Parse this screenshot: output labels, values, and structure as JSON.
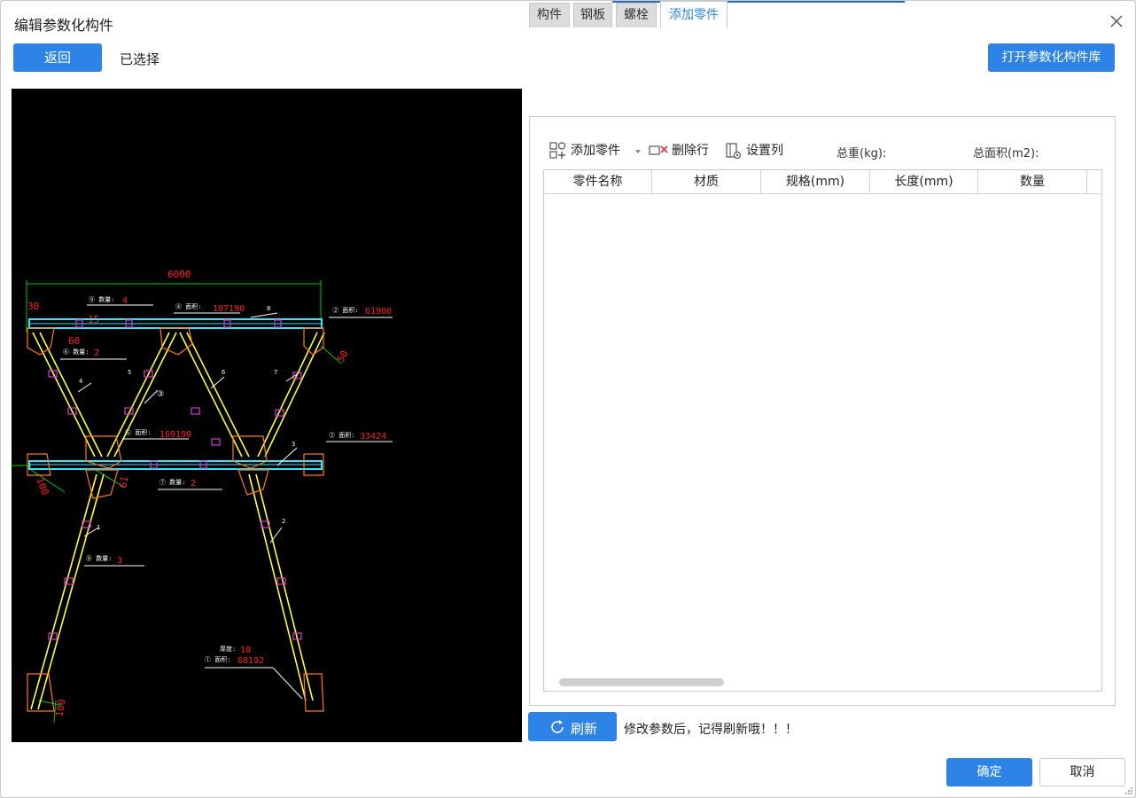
{
  "window": {
    "title": "编辑参数化构件",
    "close_icon": "close-icon"
  },
  "header": {
    "back_label": "返回",
    "selected_label": "已选择",
    "open_library_label": "打开参数化构件库"
  },
  "drawing": {
    "dimensions": {
      "top_width": "6000",
      "left_30": "30",
      "left_60": "60",
      "right_50": "50",
      "bottom_left_100": "100",
      "mid_100": "100",
      "mid_61": "61",
      "bottom_100": "100",
      "d15": "15"
    },
    "annotations": {
      "a_top_left": {
        "label": "⑨ 数量:",
        "value": "4"
      },
      "a_top_mid": {
        "label": "④ 面积:",
        "value": "107190"
      },
      "a_top_right": {
        "label": "② 面积:",
        "value": "61900"
      },
      "a_mid_left": {
        "label": "⑥ 数量:",
        "value": "2"
      },
      "a_center": {
        "label": "⑤ 面积:",
        "value": "169190"
      },
      "a_mid_right": {
        "label": "② 面积:",
        "value": "33424"
      },
      "a_low_center": {
        "label": "⑦ 数量:",
        "value": "2"
      },
      "a_low_left": {
        "label": "⑧ 数量:",
        "value": "3"
      },
      "a_bottom_thk": {
        "label": "厚度:",
        "value": "10"
      },
      "a_bottom_area": {
        "label": "① 面积:",
        "value": "68192"
      }
    },
    "part_marks": {
      "m8": "8",
      "m4": "4",
      "m5": "5",
      "m6": "6",
      "m7": "7",
      "m3": "3",
      "m2": "2",
      "m1": "1",
      "circ3": "③"
    },
    "colors": {
      "background": "#000000",
      "member": "#ffff33",
      "beam": "#33e6ff",
      "plate": "#ff7a1a",
      "bolt": "#d63bd6",
      "dimension": "#00c800",
      "annotation": "#ffffff",
      "value": "#ff2020"
    }
  },
  "tabs": [
    {
      "label": "构件",
      "active": false
    },
    {
      "label": "钢板",
      "active": false
    },
    {
      "label": "螺栓",
      "active": false
    },
    {
      "label": "添加零件",
      "active": true
    }
  ],
  "toolbar": {
    "add_part_label": "添加零件",
    "delete_row_label": "删除行",
    "set_columns_label": "设置列",
    "total_weight_label": "总重(kg):",
    "total_area_label": "总面积(m2):"
  },
  "table": {
    "columns": [
      "零件名称",
      "材质",
      "规格(mm)",
      "长度(mm)",
      "数量"
    ],
    "rows": []
  },
  "footer": {
    "refresh_label": "刷新",
    "refresh_hint": "修改参数后，记得刷新哦！！！",
    "ok_label": "确定",
    "cancel_label": "取消"
  },
  "accent_color": "#2d84e6"
}
